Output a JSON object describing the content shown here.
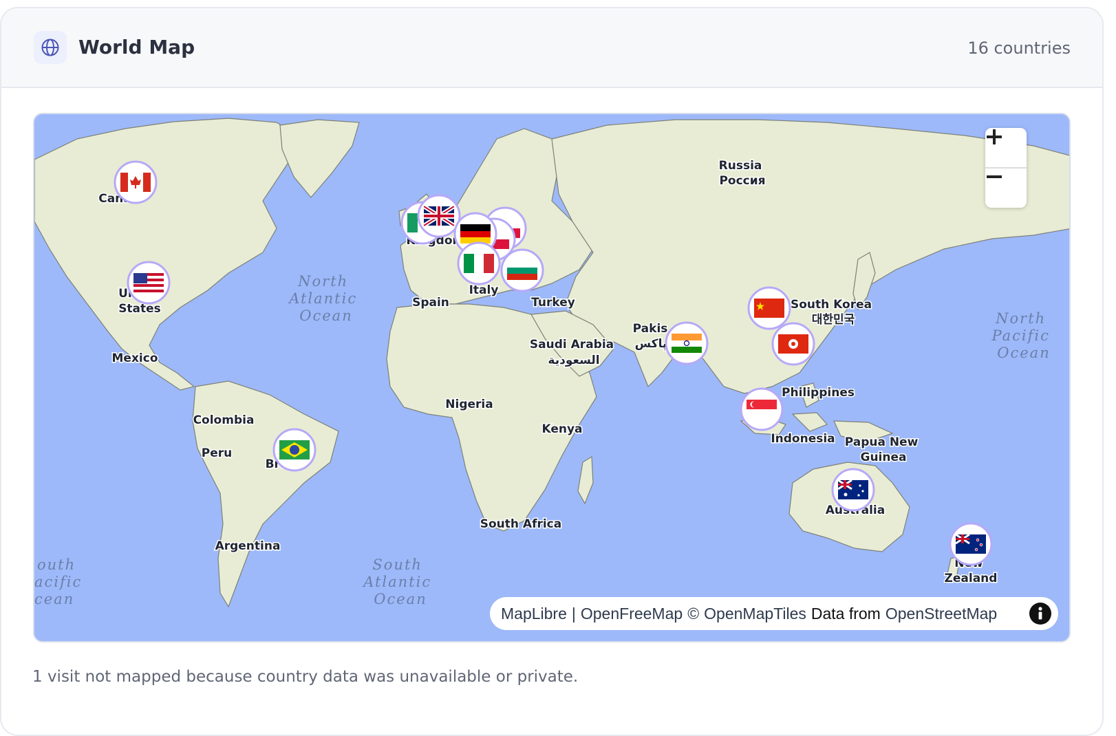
{
  "header": {
    "title": "World Map",
    "count_label": "16 countries",
    "icon": "globe-icon"
  },
  "map": {
    "ocean_labels": [
      {
        "id": "north-atlantic-ocean",
        "lines": [
          "North",
          "Atlantic",
          "Ocean"
        ]
      },
      {
        "id": "south-atlantic-ocean",
        "lines": [
          "South",
          "Atlantic",
          "Ocean"
        ]
      },
      {
        "id": "north-pacific-ocean",
        "lines": [
          "North",
          "Pacific",
          "Ocean"
        ]
      },
      {
        "id": "south-pacific-ocean",
        "lines": [
          "outh",
          "acific",
          "cean"
        ]
      }
    ],
    "place_labels": [
      {
        "id": "canada",
        "lines": [
          "Cana"
        ]
      },
      {
        "id": "united-states",
        "lines": [
          "Un",
          "States"
        ]
      },
      {
        "id": "mexico",
        "lines": [
          "Mexico"
        ]
      },
      {
        "id": "colombia",
        "lines": [
          "Colombia"
        ]
      },
      {
        "id": "peru",
        "lines": [
          "Peru"
        ]
      },
      {
        "id": "brazil",
        "lines": [
          "Bra"
        ]
      },
      {
        "id": "argentina",
        "lines": [
          "Argentina"
        ]
      },
      {
        "id": "united-kingdom",
        "lines": [
          "Kingdon"
        ]
      },
      {
        "id": "spain",
        "lines": [
          "Spain"
        ]
      },
      {
        "id": "italy",
        "lines": [
          "Italy"
        ]
      },
      {
        "id": "turkey",
        "lines": [
          "Turkey"
        ]
      },
      {
        "id": "saudi-arabia",
        "lines": [
          "Saudi Arabia",
          "السعودية"
        ]
      },
      {
        "id": "nigeria",
        "lines": [
          "Nigeria"
        ]
      },
      {
        "id": "kenya",
        "lines": [
          "Kenya"
        ]
      },
      {
        "id": "south-africa",
        "lines": [
          "South Africa"
        ]
      },
      {
        "id": "russia",
        "lines": [
          "Russia",
          "Россия"
        ]
      },
      {
        "id": "pakistan",
        "lines": [
          "Pakis",
          "پاکس"
        ]
      },
      {
        "id": "south-korea",
        "lines": [
          "South Korea",
          "대한민국"
        ]
      },
      {
        "id": "philippines",
        "lines": [
          "Philippines"
        ]
      },
      {
        "id": "indonesia",
        "lines": [
          "Indonesia"
        ]
      },
      {
        "id": "papua-new-guinea",
        "lines": [
          "Papua New",
          "Guinea"
        ]
      },
      {
        "id": "australia",
        "lines": [
          "Australia"
        ]
      },
      {
        "id": "new-zealand",
        "lines": [
          "New",
          "Zealand"
        ]
      }
    ],
    "markers": [
      {
        "country": "Canada",
        "flag": "canada"
      },
      {
        "country": "United States",
        "flag": "united-states"
      },
      {
        "country": "Brazil",
        "flag": "brazil"
      },
      {
        "country": "Ireland",
        "flag": "ireland"
      },
      {
        "country": "United Kingdom",
        "flag": "united-kingdom"
      },
      {
        "country": "Poland",
        "flag": "poland"
      },
      {
        "country": "Germany",
        "flag": "germany"
      },
      {
        "country": "Italy",
        "flag": "italy"
      },
      {
        "country": "Bulgaria",
        "flag": "bulgaria"
      },
      {
        "country": "India",
        "flag": "india"
      },
      {
        "country": "China",
        "flag": "china"
      },
      {
        "country": "Hong Kong",
        "flag": "hong-kong"
      },
      {
        "country": "Singapore",
        "flag": "singapore"
      },
      {
        "country": "Australia",
        "flag": "australia"
      },
      {
        "country": "New Zealand",
        "flag": "new-zealand"
      }
    ],
    "zoom_in_icon": "plus-icon",
    "zoom_out_icon": "minus-icon",
    "attribution": {
      "maplibre": "MapLibre",
      "sep": "|",
      "openfreemap": "OpenFreeMap",
      "copyright": "©",
      "openmaptiles": "OpenMapTiles",
      "data_from": "Data from",
      "openstreetmap": "OpenStreetMap",
      "info_icon": "info-icon"
    }
  },
  "footer": {
    "note": "1 visit not mapped because country data was unavailable or private."
  },
  "colors": {
    "ocean": "#9db9fa",
    "land": "#e8ecd4",
    "marker_ring": "#c4b5fd",
    "accent": "#5b63c7"
  }
}
